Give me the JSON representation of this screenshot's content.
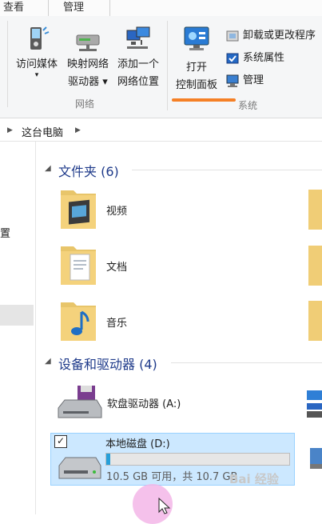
{
  "ribbon": {
    "tabs": [
      {
        "label": "查看"
      },
      {
        "label": "管理"
      }
    ],
    "network_group": {
      "label": "网络",
      "buttons": [
        {
          "line1": "访问媒体",
          "line2": "▾",
          "icon": "media-access-icon"
        },
        {
          "line1": "映射网络",
          "line2": "驱动器 ▾",
          "icon": "map-network-drive-icon"
        },
        {
          "line1": "添加一个",
          "line2": "网络位置",
          "icon": "add-network-location-icon"
        }
      ]
    },
    "system_group": {
      "label": "系统",
      "open_control_panel": {
        "line1": "打开",
        "line2": "控制面板",
        "icon": "control-panel-icon"
      },
      "side_items": [
        {
          "label": "卸载或更改程序",
          "icon": "uninstall-program-icon"
        },
        {
          "label": "系统属性",
          "icon": "system-properties-icon"
        },
        {
          "label": "管理",
          "icon": "manage-icon"
        }
      ]
    }
  },
  "address_bar": {
    "path": "这台电脑"
  },
  "nav_pane": {
    "partial_label": "置"
  },
  "content": {
    "folders_section": {
      "title": "文件夹 (6)",
      "items": [
        {
          "label": "视频",
          "icon": "videos-folder-icon"
        },
        {
          "label": "文档",
          "icon": "documents-folder-icon"
        },
        {
          "label": "音乐",
          "icon": "music-folder-icon"
        }
      ]
    },
    "devices_section": {
      "title": "设备和驱动器 (4)",
      "drives": [
        {
          "label": "软盘驱动器 (A:)",
          "icon": "floppy-drive-icon"
        },
        {
          "label": "本地磁盘 (D:)",
          "icon": "hard-disk-icon",
          "capacity_text": "10.5 GB 可用，共 10.7 GB",
          "used_fraction": 0.02,
          "checked": true
        }
      ]
    }
  },
  "colors": {
    "accent": "#26a0da",
    "selection": "#cce8ff",
    "section_heading": "#1e3a8a",
    "highlight_bar": "#f58026"
  },
  "watermark": "Bai 经验"
}
